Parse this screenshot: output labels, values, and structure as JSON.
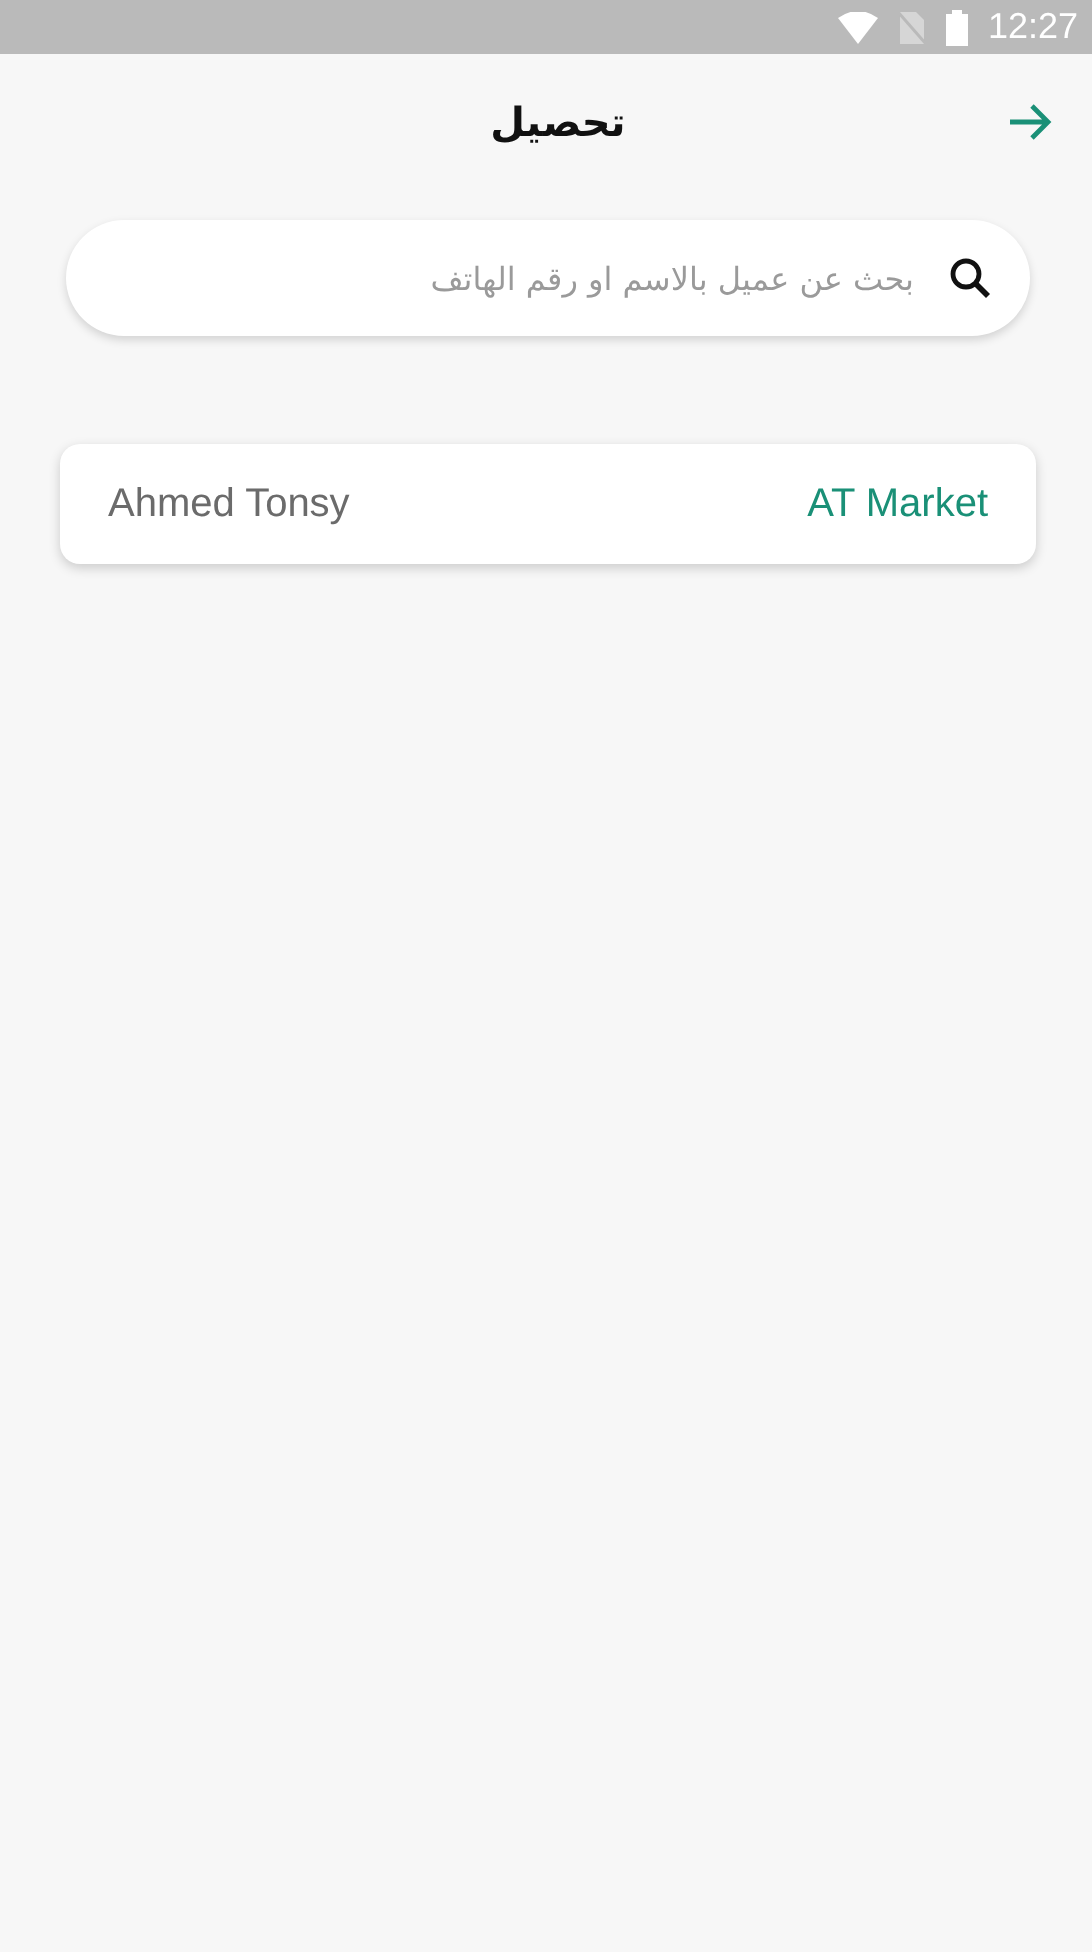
{
  "status_bar": {
    "time": "12:27"
  },
  "header": {
    "title": "تحصيل"
  },
  "search": {
    "placeholder": "بحث عن عميل بالاسم او رقم الهاتف"
  },
  "customers": [
    {
      "store": "AT Market",
      "name": "Ahmed Tonsy"
    }
  ]
}
